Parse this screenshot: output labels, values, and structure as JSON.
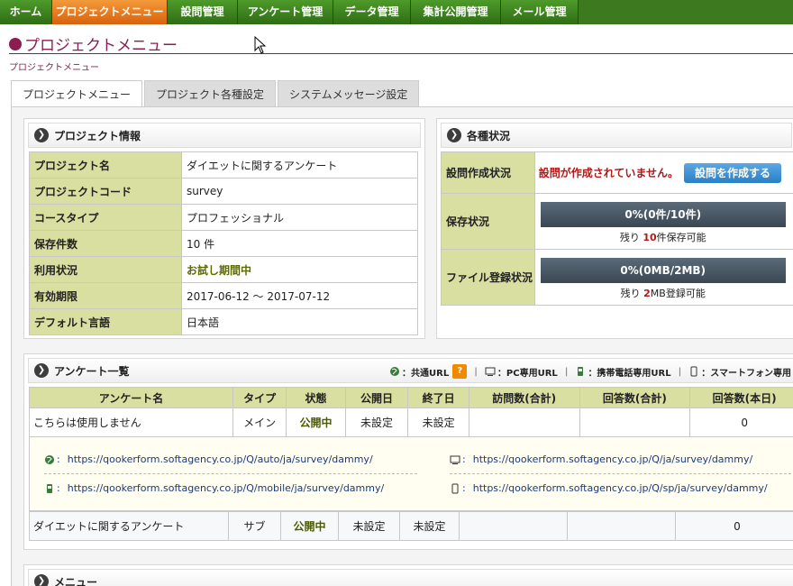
{
  "nav": {
    "items": [
      {
        "label": "ホーム",
        "width": 58
      },
      {
        "label": "プロジェクトメニュー",
        "width": 128,
        "active": true
      },
      {
        "label": "設問管理",
        "width": 78
      },
      {
        "label": "アンケート管理",
        "width": 106
      },
      {
        "label": "データ管理",
        "width": 86
      },
      {
        "label": "集計公開管理",
        "width": 100
      },
      {
        "label": "メール管理",
        "width": 86
      }
    ]
  },
  "page": {
    "title": "プロジェクトメニュー",
    "breadcrumb": "プロジェクトメニュー"
  },
  "tabs": [
    "プロジェクトメニュー",
    "プロジェクト各種設定",
    "システムメッセージ設定"
  ],
  "project_info": {
    "header": "プロジェクト情報",
    "rows": [
      {
        "key": "プロジェクト名",
        "value": "ダイエットに関するアンケート"
      },
      {
        "key": "プロジェクトコード",
        "value": "survey"
      },
      {
        "key": "コースタイプ",
        "value": "プロフェッショナル"
      },
      {
        "key": "保存件数",
        "value": "10 件"
      },
      {
        "key": "利用状況",
        "value": "お試し期間中"
      },
      {
        "key": "有効期限",
        "value": "2017-06-12 ～ 2017-07-12"
      },
      {
        "key": "デフォルト言語",
        "value": "日本語"
      }
    ]
  },
  "status": {
    "header": "各種状況",
    "question_label": "設問作成状況",
    "question_warning": "設問が作成されていません。",
    "create_button": "設問を作成する",
    "storage_label": "保存状況",
    "storage_bar": "0%(0件/10件)",
    "storage_fill": 0,
    "storage_remain_pre": "残り",
    "storage_remain_num": "10",
    "storage_remain_post": "件保存可能",
    "file_label": "ファイル登録状況",
    "file_bar": "0%(0MB/2MB)",
    "file_fill": 0,
    "file_remain_pre": "残り",
    "file_remain_num": "2",
    "file_remain_post": "MB登録可能"
  },
  "survey_list": {
    "header": "アンケート一覧",
    "legend": {
      "common": "：共通URL",
      "help": "?",
      "pc": "：PC専用URL",
      "mobile": "：携帯電話専用URL",
      "smartphone": "：スマートフォン専用"
    },
    "columns": [
      "アンケート名",
      "タイプ",
      "状態",
      "公開日",
      "終了日",
      "訪問数(合計)",
      "回答数(合計)",
      "回答数(本日)"
    ],
    "rows": [
      {
        "name": "こちらは使用しません",
        "type": "メイン",
        "state": "公開中",
        "open": "未設定",
        "end": "未設定",
        "visits": "",
        "answers": "",
        "today": "0"
      },
      {
        "name": "ダイエットに関するアンケート",
        "type": "サブ",
        "state": "公開中",
        "open": "未設定",
        "end": "未設定",
        "visits": "",
        "answers": "",
        "today": "0"
      }
    ],
    "urls": {
      "common": "https://qookerform.softagency.co.jp/Q/auto/ja/survey/dammy/",
      "pc": "https://qookerform.softagency.co.jp/Q/ja/survey/dammy/",
      "mobile": "https://qookerform.softagency.co.jp/Q/mobile/ja/survey/dammy/",
      "smartphone": "https://qookerform.softagency.co.jp/Q/sp/ja/survey/dammy/"
    }
  },
  "menu": {
    "header": "メニュー"
  },
  "colors": {
    "accent": "#8a1f4f",
    "nav_green": "#3d7a1f",
    "nav_active": "#e7761e",
    "header_cell": "#d9dfa0"
  }
}
